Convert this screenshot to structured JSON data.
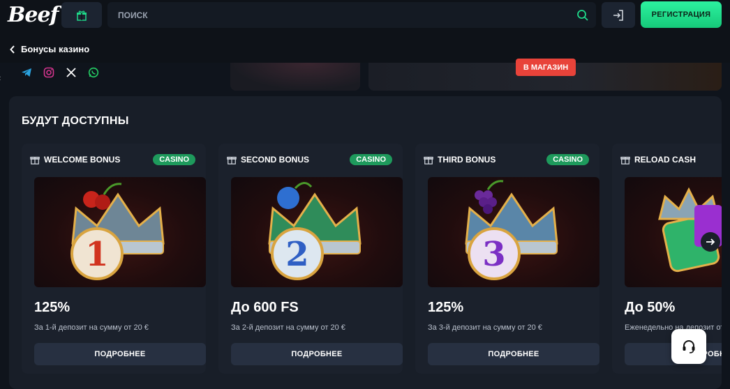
{
  "header": {
    "logo": "Beef",
    "search_placeholder": "ПОИСК",
    "register_label": "РЕГИСТРАЦИЯ"
  },
  "subheader": {
    "back_label": "Бонусы казино"
  },
  "promo": {
    "shop_label": "В МАГАЗИН"
  },
  "section": {
    "title": "БУДУТ ДОСТУПНЫ"
  },
  "cards": [
    {
      "title": "WELCOME BONUS",
      "badge": "CASINO",
      "number": "1",
      "value": "125%",
      "desc": "За 1-й депозит на сумму от 20 €",
      "button": "ПОДРОБНЕЕ"
    },
    {
      "title": "SECOND BONUS",
      "badge": "CASINO",
      "number": "2",
      "value": "До 600 FS",
      "desc": "За 2-й депозит на сумму от 20 €",
      "button": "ПОДРОБНЕЕ"
    },
    {
      "title": "THIRD BONUS",
      "badge": "CASINO",
      "number": "3",
      "value": "125%",
      "desc": "За 3-й депозит на сумму от 20 €",
      "button": "ПОДРОБНЕЕ"
    },
    {
      "title": "RELOAD CASH",
      "badge": "",
      "number": "",
      "value": "До 50%",
      "desc": "Еженедельно на депозит от",
      "button": "ПОДРОБНЕЕ"
    }
  ],
  "colors": {
    "accent": "#1fd98a",
    "badge": "#1e9a5c",
    "shop": "#e8433a"
  }
}
